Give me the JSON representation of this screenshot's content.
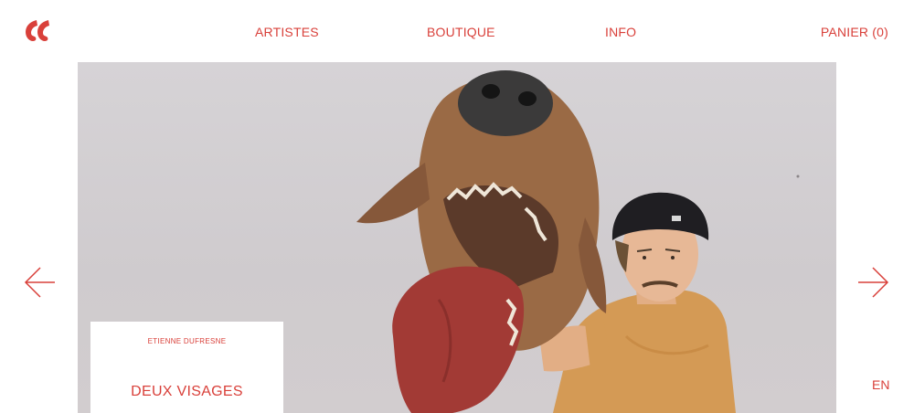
{
  "header": {
    "logo": "logo-icon",
    "nav": {
      "artistes": "ARTISTES",
      "boutique": "BOUTIQUE",
      "info": "INFO",
      "panier": "PANIER (0)"
    }
  },
  "hero": {
    "image": "artist-with-dog-puppet-photo",
    "caption": {
      "artist": "ETIENNE DUFRESNE",
      "title": "DEUX VISAGES"
    }
  },
  "carousel": {
    "prev_icon": "arrow-left-icon",
    "next_icon": "arrow-right-icon"
  },
  "language": "EN",
  "colors": {
    "accent": "#d9403a",
    "background": "#ffffff",
    "photo_backdrop": "#d3cfd2"
  }
}
